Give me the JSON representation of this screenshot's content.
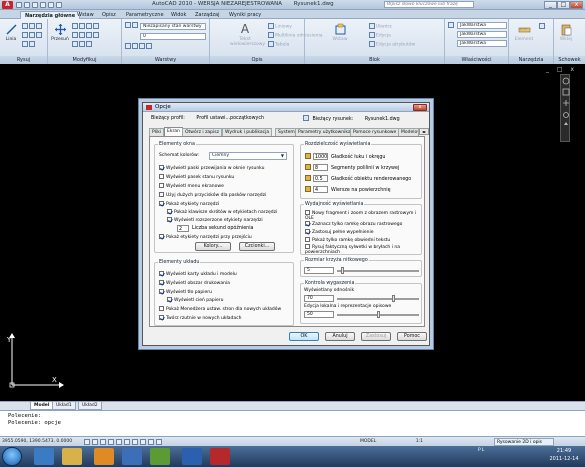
{
  "window": {
    "app_title": "AutoCAD 2010 - WERSJA NIEZAREJESTROWANA",
    "doc_title": "Rysunek1.dwg",
    "help_placeholder": "Wpisz słowo kluczowe lub frazę",
    "minimize": "_",
    "maximize": "□",
    "close": "x"
  },
  "ribbon": {
    "tabs": [
      "Narzędzia główne",
      "Wstaw",
      "Opisz",
      "Parametryczne",
      "Widok",
      "Zarządzaj",
      "Wyniki pracy"
    ],
    "panels": {
      "draw": "Rysuj",
      "modify": "Modyfikuj",
      "layers": "Warstwy",
      "annotation": "Opis",
      "block": "Blok",
      "properties": "Właściwości",
      "utilities": "Narzędzia",
      "clipboard": "Schowek"
    },
    "buttons": {
      "line": "Linia",
      "move": "Przesuń",
      "text": "Tekst wielowierszowy",
      "insert": "Wstaw",
      "element": "Element",
      "paste": "Wklej"
    },
    "small": {
      "layer_state": "Niezapisany stan warstwy",
      "dimension": "Liniowy",
      "multileader": "Multilinia odniesienia",
      "table": "Tabela",
      "create": "Utwórz",
      "edit": "Edycja",
      "edit_attr": "Edycja atrybutów"
    },
    "property_values": [
      "JakWarstwa",
      "JakWarstwa",
      "JakWarstwa"
    ],
    "layer_value": "0",
    "by_color": "JakWarstwa"
  },
  "drawing": {
    "doc_controls": "_ □ x",
    "ucs_y": "Y",
    "ucs_x": "X"
  },
  "layout_tabs": [
    "Model",
    "Układ1",
    "Układ2"
  ],
  "command_line": {
    "line1": "Polecenie:",
    "line2": "Polecenie: opcje"
  },
  "status": {
    "coords": "3955.0590, 1390.5473, 0.0000",
    "model": "MODEL",
    "scale": "1:1",
    "workspace": "Rysowanie 2D i opis"
  },
  "taskbar": {
    "tray": "PL",
    "time": "21:49",
    "date": "2011-12-14"
  },
  "dialog": {
    "title": "Opcje",
    "current_profile_label": "Bieżący profil:",
    "current_profile_value": "Profil ustawi...początkowych",
    "current_drawing_label": "Bieżący rysunek:",
    "current_drawing_value": "Rysunek1.dwg",
    "tabs": [
      "Pliki",
      "Ekran",
      "Otwórz i zapisz",
      "Wydruk i publikacja",
      "System",
      "Parametry użytkownika",
      "Pomoce rysunkowe",
      "Modelov"
    ],
    "active_tab": "Ekran",
    "window_elements": {
      "title": "Elementy okna",
      "color_scheme_label": "Schemat kolorów:",
      "color_scheme_value": "Ciemny",
      "checkboxes": [
        {
          "label": "Wyświetl paski przewijania w oknie rysunku",
          "checked": true
        },
        {
          "label": "Wyświetl pasek stanu rysunku",
          "checked": false
        },
        {
          "label": "Wyświetl menu ekranowe",
          "checked": false
        },
        {
          "label": "Użyj dużych przycisków dla pasków narzędzi",
          "checked": false
        },
        {
          "label": "Pokaż etykiety narzędzi",
          "checked": true
        },
        {
          "label": "Pokaż klawisze skrótów w etykietach narzędzi",
          "checked": true
        },
        {
          "label": "Wyświetl rozszerzone etykiety narzędzi",
          "checked": true
        }
      ],
      "delay_value": "2",
      "delay_label": "Liczba sekund opóźnienia",
      "rollover_label": "Pokaż etykiety narzędzi przy przejściu",
      "rollover_checked": true,
      "colors_button": "Kolory...",
      "fonts_button": "Czcionki..."
    },
    "layout_elements": {
      "title": "Elementy układu",
      "checkboxes": [
        {
          "label": "Wyświetl karty układu i modelu",
          "checked": true
        },
        {
          "label": "Wyświetl obszar drukowania",
          "checked": true
        },
        {
          "label": "Wyświetl tło papieru",
          "checked": true
        },
        {
          "label": "Wyświetl cień papieru",
          "checked": true
        },
        {
          "label": "Pokaż Menedżera ustaw. stron dla nowych układów",
          "checked": false
        },
        {
          "label": "Twórz rzutnie w nowych układach",
          "checked": true
        }
      ]
    },
    "display_resolution": {
      "title": "Rozdzielczość wyświetlania",
      "rows": [
        {
          "value": "1000",
          "label": "Gładkość łuku i okręgu"
        },
        {
          "value": "8",
          "label": "Segmenty polilinii w krzywej"
        },
        {
          "value": "0.5",
          "label": "Gładkość obiektu renderowanego"
        },
        {
          "value": "4",
          "label": "Wiersze na powierzchnię"
        }
      ]
    },
    "display_performance": {
      "title": "Wydajność wyświetlania",
      "checkboxes": [
        {
          "label": "Nowy fragment i zoom z obrazem rastrowym i OLE",
          "checked": false
        },
        {
          "label": "Zaznacz tylko ramkę obrazu rastrowego",
          "checked": true
        },
        {
          "label": "Zastosuj pełne wypełnienie",
          "checked": true
        },
        {
          "label": "Pokaż tylko ramkę obwiedni tekstu",
          "checked": false
        },
        {
          "label": "Rysuj faktyczną sylwetki w bryłach i na powierzchniach",
          "checked": false
        }
      ]
    },
    "crosshair": {
      "title": "Rozmiar krzyża nitkowego",
      "value": "5",
      "fraction": 0.05
    },
    "fade": {
      "title": "Kontrola wygaszenia",
      "xref_label": "Wyświetlany odnośnik",
      "xref_value": "70",
      "xref_fraction": 0.7,
      "inplace_label": "Edycja lokalna i reprezentacje opisowe",
      "inplace_value": "50",
      "inplace_fraction": 0.5
    },
    "buttons": {
      "ok": "OK",
      "cancel": "Anuluj",
      "apply": "Zastosuj",
      "help": "Pomoc"
    }
  }
}
